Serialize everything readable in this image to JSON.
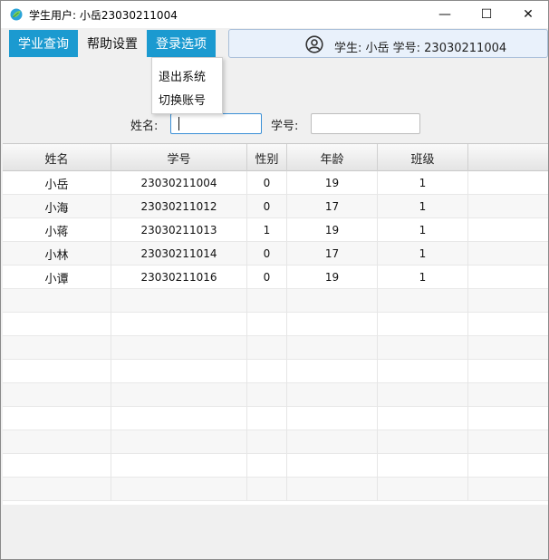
{
  "window": {
    "title": "学生用户: 小岳23030211004",
    "minimize_glyph": "—",
    "maximize_glyph": "☐",
    "close_glyph": "✕",
    "app_icon": "leaf-app-icon"
  },
  "menubar": {
    "items": [
      "学业查询",
      "帮助设置",
      "登录选项"
    ]
  },
  "dropdown": {
    "items": [
      "退出系统",
      "切换账号"
    ]
  },
  "user_panel": {
    "icon": "user-circle-icon",
    "text": "学生: 小岳 学号: 23030211004"
  },
  "search": {
    "name_label": "姓名:",
    "name_value": "",
    "id_label": "学号:",
    "id_value": ""
  },
  "table": {
    "columns": [
      "姓名",
      "学号",
      "性别",
      "年龄",
      "班级",
      ""
    ],
    "rows": [
      [
        "小岳",
        "23030211004",
        "0",
        "19",
        "1"
      ],
      [
        "小海",
        "23030211012",
        "0",
        "17",
        "1"
      ],
      [
        "小蒋",
        "23030211013",
        "1",
        "19",
        "1"
      ],
      [
        "小林",
        "23030211014",
        "0",
        "17",
        "1"
      ],
      [
        "小谭",
        "23030211016",
        "0",
        "19",
        "1"
      ]
    ]
  },
  "colors": {
    "accent": "#1b9ad0",
    "panel_bg": "#e9f1fb"
  }
}
